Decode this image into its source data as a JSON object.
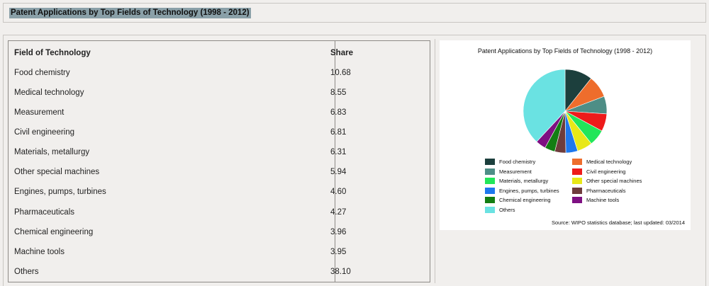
{
  "page": {
    "heading": "Patent Applications by Top Fields of Technology (1998 - 2012)"
  },
  "table": {
    "headers": {
      "field": "Field of Technology",
      "share": "Share"
    },
    "rows": [
      {
        "field": "Food chemistry",
        "share": "10.68"
      },
      {
        "field": "Medical technology",
        "share": "8.55"
      },
      {
        "field": "Measurement",
        "share": "6.83"
      },
      {
        "field": "Civil engineering",
        "share": "6.81"
      },
      {
        "field": "Materials, metallurgy",
        "share": "6.31"
      },
      {
        "field": "Other special machines",
        "share": "5.94"
      },
      {
        "field": "Engines, pumps, turbines",
        "share": "4.60"
      },
      {
        "field": "Pharmaceuticals",
        "share": "4.27"
      },
      {
        "field": "Chemical engineering",
        "share": "3.96"
      },
      {
        "field": "Machine tools",
        "share": "3.95"
      },
      {
        "field": "Others",
        "share": "38.10"
      }
    ]
  },
  "chart_data": {
    "type": "pie",
    "title": "Patent Applications by Top Fields of Technology (1998 - 2012)",
    "source": "Source: WIPO statistics database; last updated: 03/2014",
    "legend_position": "bottom",
    "slices": [
      {
        "label": "Food chemistry",
        "value": 10.68,
        "color": "#1c3f3d"
      },
      {
        "label": "Medical technology",
        "value": 8.55,
        "color": "#ee6d2c"
      },
      {
        "label": "Measurement",
        "value": 6.83,
        "color": "#4e8e86"
      },
      {
        "label": "Civil engineering",
        "value": 6.81,
        "color": "#ee1b1b"
      },
      {
        "label": "Materials, metallurgy",
        "value": 6.31,
        "color": "#22e65a"
      },
      {
        "label": "Other special machines",
        "value": 5.94,
        "color": "#e8e818"
      },
      {
        "label": "Engines, pumps, turbines",
        "value": 4.6,
        "color": "#1e78ee"
      },
      {
        "label": "Pharmaceuticals",
        "value": 4.27,
        "color": "#6e3c3c"
      },
      {
        "label": "Chemical engineering",
        "value": 3.96,
        "color": "#137e13"
      },
      {
        "label": "Machine tools",
        "value": 3.95,
        "color": "#7e1082"
      },
      {
        "label": "Others",
        "value": 38.1,
        "color": "#6ae2e2"
      }
    ]
  }
}
